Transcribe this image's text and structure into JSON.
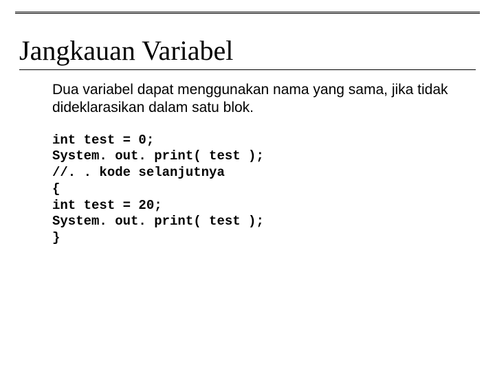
{
  "slide": {
    "title": "Jangkauan Variabel",
    "body": "Dua variabel dapat menggunakan nama yang sama, jika tidak dideklarasikan dalam satu blok.",
    "code": "int test = 0;\nSystem. out. print( test );\n//. . kode selanjutnya\n{\nint test = 20;\nSystem. out. print( test );\n}"
  }
}
